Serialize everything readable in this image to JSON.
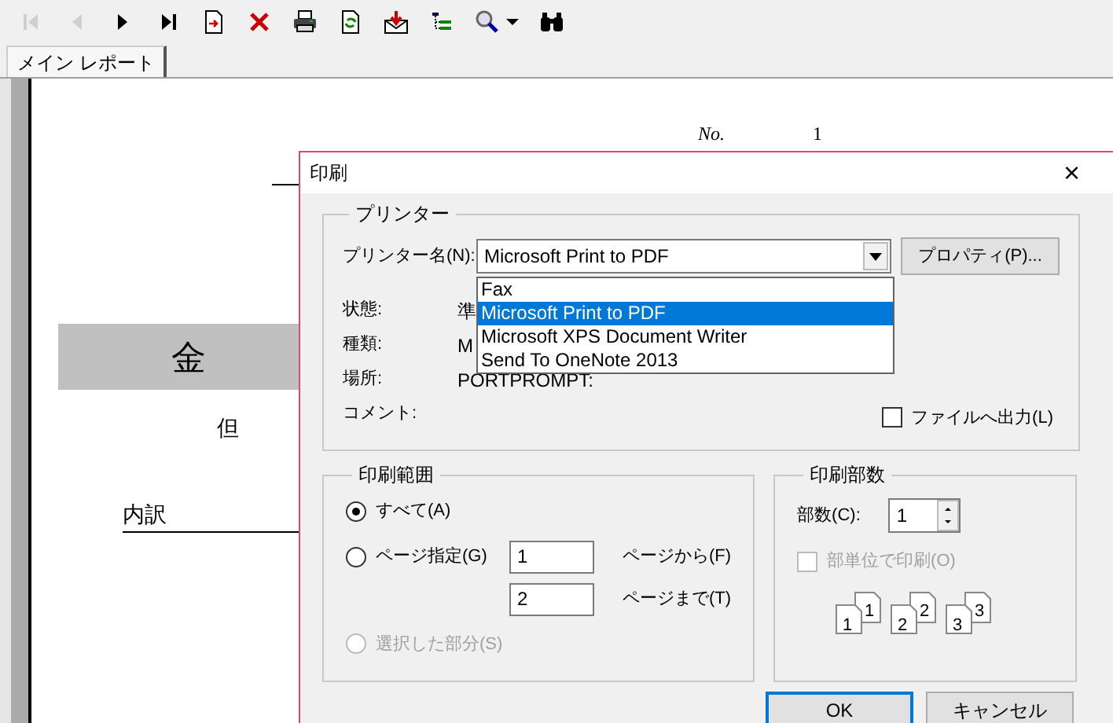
{
  "toolbar": [
    {
      "kind": "first",
      "disabled": true
    },
    {
      "kind": "prev",
      "disabled": true
    },
    {
      "kind": "next",
      "disabled": false
    },
    {
      "kind": "last",
      "disabled": false
    },
    {
      "kind": "goto",
      "disabled": false
    },
    {
      "kind": "cancel",
      "disabled": false
    },
    {
      "kind": "print",
      "disabled": false
    },
    {
      "kind": "refresh",
      "disabled": false
    },
    {
      "kind": "export",
      "disabled": false
    },
    {
      "kind": "tree",
      "disabled": false
    },
    {
      "kind": "zoom",
      "disabled": false
    },
    {
      "kind": "find",
      "disabled": false
    }
  ],
  "tabs": [
    {
      "label": "メイン レポート",
      "selected": true
    }
  ],
  "report": {
    "no_label": "No.",
    "no_value": "1",
    "amount_label": "金",
    "note_label": "但",
    "breakdown_label": "内訳"
  },
  "dialog": {
    "title": "印刷",
    "close": "×",
    "printer": {
      "legend": "プリンター",
      "name_label": "プリンター名(N):",
      "name_value": "Microsoft Print to PDF",
      "properties_button": "プロパティ(P)...",
      "options": [
        {
          "label": "Fax",
          "selected": false
        },
        {
          "label": "Microsoft Print to PDF",
          "selected": true
        },
        {
          "label": "Microsoft XPS Document Writer",
          "selected": false
        },
        {
          "label": "Send To OneNote 2013",
          "selected": false
        }
      ],
      "info": [
        {
          "label": "状態:",
          "value": "準"
        },
        {
          "label": "種類:",
          "value": "M"
        },
        {
          "label": "場所:",
          "value": "PORTPROMPT:"
        },
        {
          "label": "コメント:"
        }
      ],
      "file_output": {
        "label": "ファイルへ出力(L)",
        "checked": false
      }
    },
    "range": {
      "legend": "印刷範囲",
      "options": [
        {
          "label": "すべて(A)",
          "selected": true,
          "disabled": false
        },
        {
          "label": "ページ指定(G)",
          "selected": false,
          "disabled": false
        },
        {
          "label": "選択した部分(S)",
          "selected": false,
          "disabled": true
        }
      ],
      "from_value": "1",
      "from_label": "ページから(F)",
      "to_value": "2",
      "to_label": "ページまで(T)"
    },
    "copies": {
      "legend": "印刷部数",
      "count_label": "部数(C):",
      "count_value": "1",
      "collate": {
        "label": "部単位で印刷(O)",
        "checked": false,
        "disabled": true
      },
      "pages": [
        [
          "1",
          "1"
        ],
        [
          "2",
          "2"
        ],
        [
          "3",
          "3"
        ]
      ]
    },
    "buttons": [
      "OK",
      "キャンセル"
    ]
  }
}
